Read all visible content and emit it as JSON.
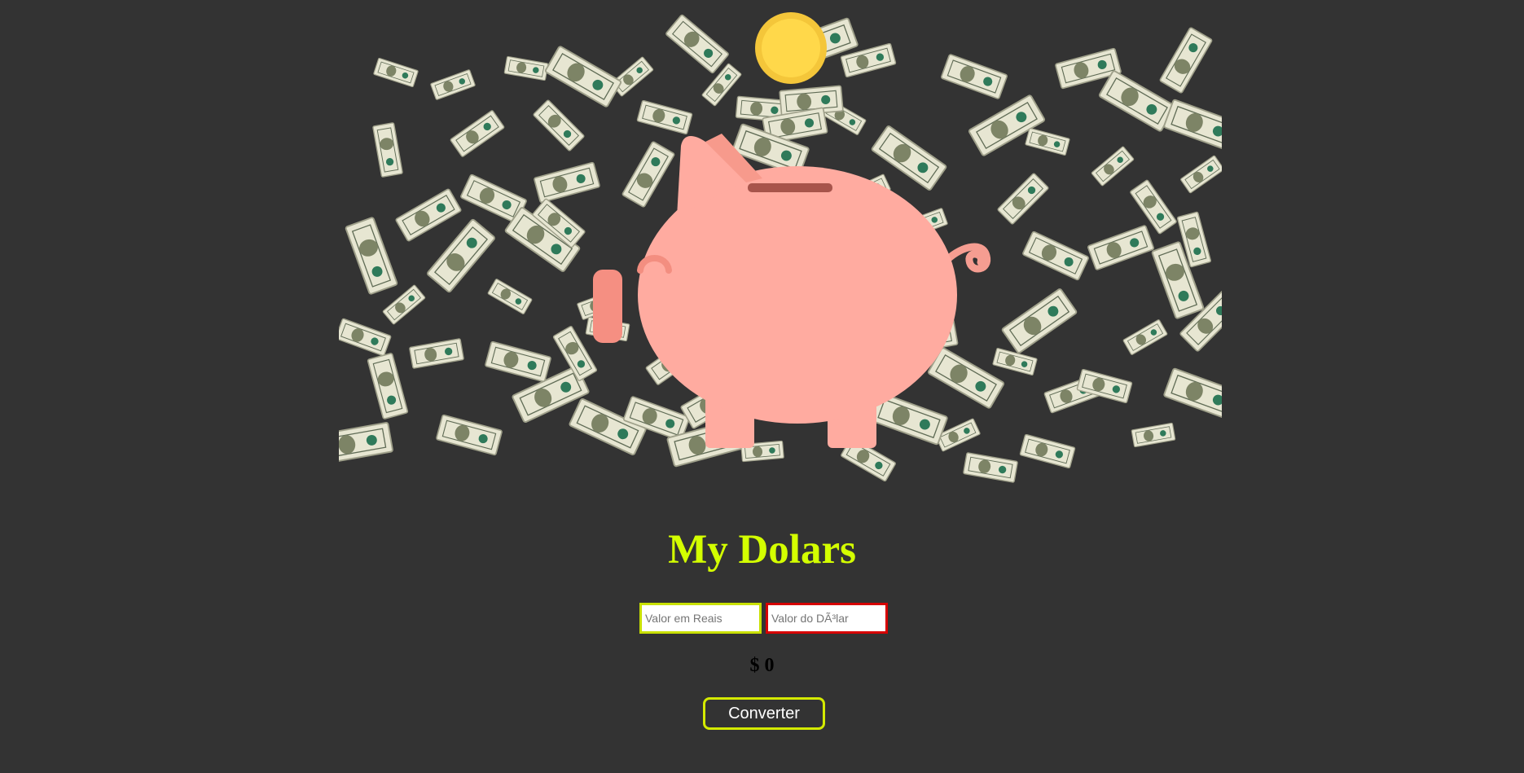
{
  "colors": {
    "background": "#333333",
    "accent": "#d4ff00",
    "title": "#d4ff00",
    "input_reais_border": "#c8e000",
    "input_dolar_border": "#d60000",
    "button_border": "#d4ea00",
    "pig": "#ffaba0",
    "coin": "#ffd43b"
  },
  "hero": {
    "image": "piggy-bank-with-falling-dollars",
    "icons": [
      "piggy-bank-icon",
      "coin-icon",
      "dollar-bill-icon"
    ]
  },
  "title": "My Dolars",
  "inputs": {
    "reais_placeholder": "Valor em Reais",
    "dolar_placeholder": "Valor do DÃ³lar",
    "reais_value": "",
    "dolar_value": ""
  },
  "result": "$ 0",
  "button": {
    "label": "Converter"
  }
}
